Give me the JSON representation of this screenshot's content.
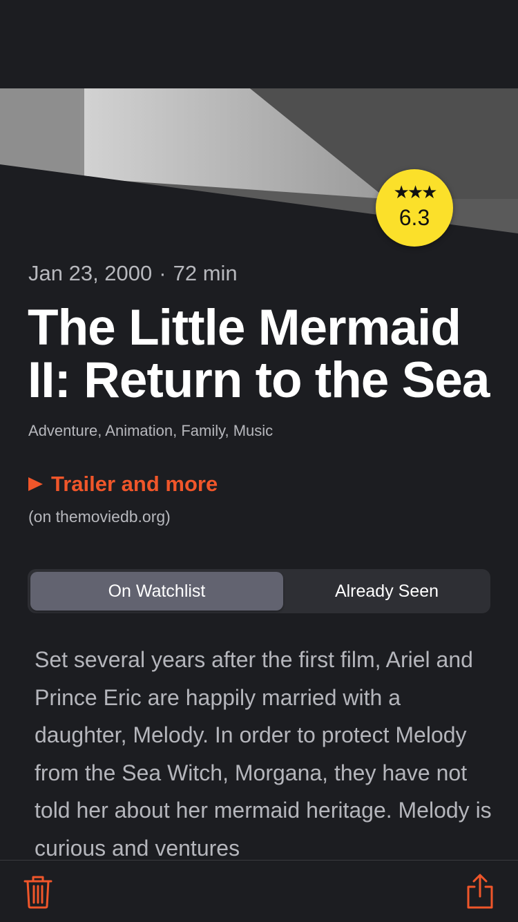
{
  "movie": {
    "rating": {
      "stars": "★★★",
      "score": "6.3"
    },
    "release_date": "Jan 23, 2000",
    "separator": "·",
    "runtime": "72 min",
    "title": "The Little Mermaid II: Return to the Sea",
    "genres": "Adventure, Animation, Family, Music",
    "overview": "Set several years after the first film, Ariel and Prince Eric are happily married with a daughter, Melody. In order to protect Melody from the Sea Witch, Morgana, they have not told her about her mermaid heritage. Melody is curious and ventures"
  },
  "links": {
    "trailer_label": "Trailer and more",
    "trailer_source": "(on themoviedb.org)"
  },
  "watch_status": {
    "options": [
      "On Watchlist",
      "Already Seen"
    ],
    "selected": "On Watchlist"
  },
  "toolbar": {
    "left_icon": "trash-icon",
    "right_icon": "share-icon"
  },
  "colors": {
    "accent": "#f0562a",
    "rating_badge": "#fbe02a",
    "background": "#1c1d21"
  }
}
